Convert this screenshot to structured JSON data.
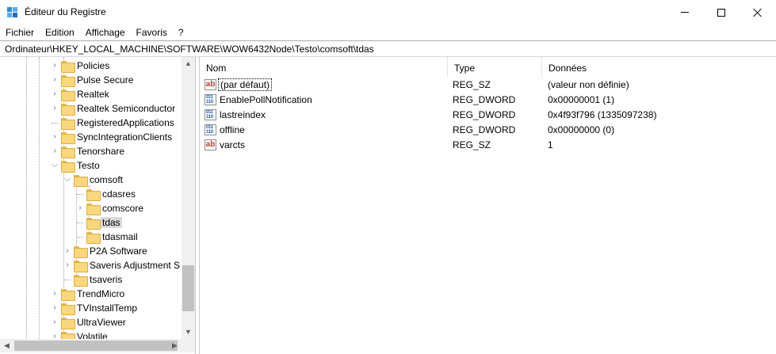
{
  "window": {
    "title": "Éditeur du Registre",
    "minimize_icon": "minimize-icon",
    "maximize_icon": "maximize-icon",
    "close_icon": "close-icon"
  },
  "menu": [
    "Fichier",
    "Edition",
    "Affichage",
    "Favoris",
    "?"
  ],
  "address": "Ordinateur\\HKEY_LOCAL_MACHINE\\SOFTWARE\\WOW6432Node\\Testo\\comsoft\\tdas",
  "tree": {
    "items": [
      {
        "label": "Policies",
        "expander": "collapsed"
      },
      {
        "label": "Pulse Secure",
        "expander": "collapsed"
      },
      {
        "label": "Realtek",
        "expander": "collapsed"
      },
      {
        "label": "Realtek Semiconductor",
        "expander": "collapsed"
      },
      {
        "label": "RegisteredApplications",
        "expander": "none"
      },
      {
        "label": "SyncIntegrationClients",
        "expander": "collapsed"
      },
      {
        "label": "Tenorshare",
        "expander": "collapsed"
      },
      {
        "label": "Testo",
        "expander": "expanded"
      },
      {
        "label": "comsoft",
        "expander": "expanded"
      },
      {
        "label": "cdasres",
        "expander": "none"
      },
      {
        "label": "comscore",
        "expander": "collapsed"
      },
      {
        "label": "tdas",
        "expander": "none",
        "selected": true
      },
      {
        "label": "tdasmail",
        "expander": "none"
      },
      {
        "label": "P2A Software",
        "expander": "collapsed"
      },
      {
        "label": "Saveris Adjustment S",
        "expander": "collapsed"
      },
      {
        "label": "tsaveris",
        "expander": "none"
      },
      {
        "label": "TrendMicro",
        "expander": "collapsed"
      },
      {
        "label": "TVInstallTemp",
        "expander": "collapsed"
      },
      {
        "label": "UltraViewer",
        "expander": "collapsed"
      },
      {
        "label": "Volatile",
        "expander": "collapsed"
      }
    ]
  },
  "values": {
    "columns": {
      "name": "Nom",
      "type": "Type",
      "data": "Données"
    },
    "rows": [
      {
        "name": "(par défaut)",
        "type": "REG_SZ",
        "data": "(valeur non définie)",
        "icon": "string-value-icon"
      },
      {
        "name": "EnablePollNotification",
        "type": "REG_DWORD",
        "data": "0x00000001 (1)",
        "icon": "dword-value-icon"
      },
      {
        "name": "lastreindex",
        "type": "REG_DWORD",
        "data": "0x4f93f796 (1335097238)",
        "icon": "dword-value-icon"
      },
      {
        "name": "offline",
        "type": "REG_DWORD",
        "data": "0x00000000 (0)",
        "icon": "dword-value-icon"
      },
      {
        "name": "varcts",
        "type": "REG_SZ",
        "data": "1",
        "icon": "string-value-icon"
      }
    ]
  },
  "icons": {
    "string_glyph": "ab",
    "dword_glyph": "011\n110"
  }
}
